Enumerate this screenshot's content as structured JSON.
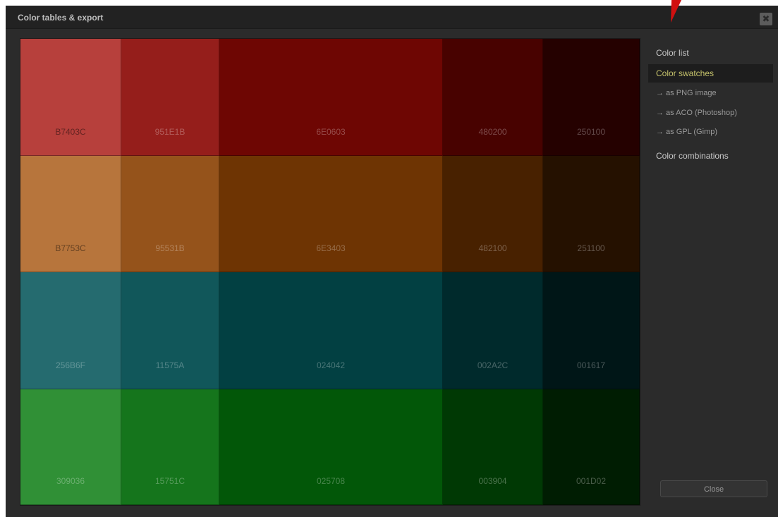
{
  "dialog": {
    "title": "Color tables & export",
    "close_icon": "close-icon",
    "close_glyph": "✖",
    "accent_color": "#c6c36b"
  },
  "swatches": {
    "rows": [
      [
        {
          "code": "B7403C",
          "hex": "#B7403C"
        },
        {
          "code": "951E1B",
          "hex": "#951E1B"
        },
        {
          "code": "6E0603",
          "hex": "#6E0603"
        },
        {
          "code": "480200",
          "hex": "#480200"
        },
        {
          "code": "250100",
          "hex": "#250100"
        }
      ],
      [
        {
          "code": "B7753C",
          "hex": "#B7753C"
        },
        {
          "code": "95531B",
          "hex": "#95531B"
        },
        {
          "code": "6E3403",
          "hex": "#6E3403"
        },
        {
          "code": "482100",
          "hex": "#482100"
        },
        {
          "code": "251100",
          "hex": "#251100"
        }
      ],
      [
        {
          "code": "256B6F",
          "hex": "#256B6F"
        },
        {
          "code": "11575A",
          "hex": "#11575A"
        },
        {
          "code": "024042",
          "hex": "#024042"
        },
        {
          "code": "002A2C",
          "hex": "#002A2C"
        },
        {
          "code": "001617",
          "hex": "#001617"
        }
      ],
      [
        {
          "code": "309036",
          "hex": "#309036"
        },
        {
          "code": "15751C",
          "hex": "#15751C"
        },
        {
          "code": "025708",
          "hex": "#025708"
        },
        {
          "code": "003904",
          "hex": "#003904"
        },
        {
          "code": "001D02",
          "hex": "#001D02"
        }
      ]
    ]
  },
  "sidebar": {
    "items": [
      {
        "label": "Color list",
        "kind": "main",
        "active": false
      },
      {
        "label": "Color swatches",
        "kind": "main",
        "active": true
      },
      {
        "label": "→ as PNG image",
        "kind": "sub",
        "active": false
      },
      {
        "label": "→ as ACO (Photoshop)",
        "kind": "sub",
        "active": false
      },
      {
        "label": "→ as GPL (Gimp)",
        "kind": "sub",
        "active": false
      },
      {
        "label": "Color combinations",
        "kind": "main",
        "active": false
      }
    ],
    "close_button": "Close"
  },
  "arrow_color": "#d01010"
}
